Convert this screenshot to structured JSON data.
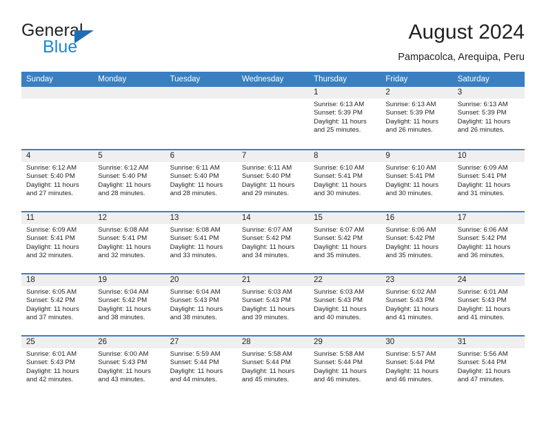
{
  "brand": {
    "name_top": "General",
    "name_bottom": "Blue",
    "triangle_color": "#1f6eb5",
    "blue_text_color": "#1b87d4"
  },
  "header": {
    "title": "August 2024",
    "subtitle": "Pampacolca, Arequipa, Peru"
  },
  "theme": {
    "header_bar_color": "#3a7fc1",
    "day_number_bg": "#efefef",
    "text_color": "#231f20"
  },
  "weekdays": [
    "Sunday",
    "Monday",
    "Tuesday",
    "Wednesday",
    "Thursday",
    "Friday",
    "Saturday"
  ],
  "weeks": [
    [
      {
        "day": "",
        "sunrise": "",
        "sunset": "",
        "daylight_line1": "",
        "daylight_line2": ""
      },
      {
        "day": "",
        "sunrise": "",
        "sunset": "",
        "daylight_line1": "",
        "daylight_line2": ""
      },
      {
        "day": "",
        "sunrise": "",
        "sunset": "",
        "daylight_line1": "",
        "daylight_line2": ""
      },
      {
        "day": "",
        "sunrise": "",
        "sunset": "",
        "daylight_line1": "",
        "daylight_line2": ""
      },
      {
        "day": "1",
        "sunrise": "Sunrise: 6:13 AM",
        "sunset": "Sunset: 5:39 PM",
        "daylight_line1": "Daylight: 11 hours",
        "daylight_line2": "and 25 minutes."
      },
      {
        "day": "2",
        "sunrise": "Sunrise: 6:13 AM",
        "sunset": "Sunset: 5:39 PM",
        "daylight_line1": "Daylight: 11 hours",
        "daylight_line2": "and 26 minutes."
      },
      {
        "day": "3",
        "sunrise": "Sunrise: 6:13 AM",
        "sunset": "Sunset: 5:39 PM",
        "daylight_line1": "Daylight: 11 hours",
        "daylight_line2": "and 26 minutes."
      }
    ],
    [
      {
        "day": "4",
        "sunrise": "Sunrise: 6:12 AM",
        "sunset": "Sunset: 5:40 PM",
        "daylight_line1": "Daylight: 11 hours",
        "daylight_line2": "and 27 minutes."
      },
      {
        "day": "5",
        "sunrise": "Sunrise: 6:12 AM",
        "sunset": "Sunset: 5:40 PM",
        "daylight_line1": "Daylight: 11 hours",
        "daylight_line2": "and 28 minutes."
      },
      {
        "day": "6",
        "sunrise": "Sunrise: 6:11 AM",
        "sunset": "Sunset: 5:40 PM",
        "daylight_line1": "Daylight: 11 hours",
        "daylight_line2": "and 28 minutes."
      },
      {
        "day": "7",
        "sunrise": "Sunrise: 6:11 AM",
        "sunset": "Sunset: 5:40 PM",
        "daylight_line1": "Daylight: 11 hours",
        "daylight_line2": "and 29 minutes."
      },
      {
        "day": "8",
        "sunrise": "Sunrise: 6:10 AM",
        "sunset": "Sunset: 5:41 PM",
        "daylight_line1": "Daylight: 11 hours",
        "daylight_line2": "and 30 minutes."
      },
      {
        "day": "9",
        "sunrise": "Sunrise: 6:10 AM",
        "sunset": "Sunset: 5:41 PM",
        "daylight_line1": "Daylight: 11 hours",
        "daylight_line2": "and 30 minutes."
      },
      {
        "day": "10",
        "sunrise": "Sunrise: 6:09 AM",
        "sunset": "Sunset: 5:41 PM",
        "daylight_line1": "Daylight: 11 hours",
        "daylight_line2": "and 31 minutes."
      }
    ],
    [
      {
        "day": "11",
        "sunrise": "Sunrise: 6:09 AM",
        "sunset": "Sunset: 5:41 PM",
        "daylight_line1": "Daylight: 11 hours",
        "daylight_line2": "and 32 minutes."
      },
      {
        "day": "12",
        "sunrise": "Sunrise: 6:08 AM",
        "sunset": "Sunset: 5:41 PM",
        "daylight_line1": "Daylight: 11 hours",
        "daylight_line2": "and 32 minutes."
      },
      {
        "day": "13",
        "sunrise": "Sunrise: 6:08 AM",
        "sunset": "Sunset: 5:41 PM",
        "daylight_line1": "Daylight: 11 hours",
        "daylight_line2": "and 33 minutes."
      },
      {
        "day": "14",
        "sunrise": "Sunrise: 6:07 AM",
        "sunset": "Sunset: 5:42 PM",
        "daylight_line1": "Daylight: 11 hours",
        "daylight_line2": "and 34 minutes."
      },
      {
        "day": "15",
        "sunrise": "Sunrise: 6:07 AM",
        "sunset": "Sunset: 5:42 PM",
        "daylight_line1": "Daylight: 11 hours",
        "daylight_line2": "and 35 minutes."
      },
      {
        "day": "16",
        "sunrise": "Sunrise: 6:06 AM",
        "sunset": "Sunset: 5:42 PM",
        "daylight_line1": "Daylight: 11 hours",
        "daylight_line2": "and 35 minutes."
      },
      {
        "day": "17",
        "sunrise": "Sunrise: 6:06 AM",
        "sunset": "Sunset: 5:42 PM",
        "daylight_line1": "Daylight: 11 hours",
        "daylight_line2": "and 36 minutes."
      }
    ],
    [
      {
        "day": "18",
        "sunrise": "Sunrise: 6:05 AM",
        "sunset": "Sunset: 5:42 PM",
        "daylight_line1": "Daylight: 11 hours",
        "daylight_line2": "and 37 minutes."
      },
      {
        "day": "19",
        "sunrise": "Sunrise: 6:04 AM",
        "sunset": "Sunset: 5:42 PM",
        "daylight_line1": "Daylight: 11 hours",
        "daylight_line2": "and 38 minutes."
      },
      {
        "day": "20",
        "sunrise": "Sunrise: 6:04 AM",
        "sunset": "Sunset: 5:43 PM",
        "daylight_line1": "Daylight: 11 hours",
        "daylight_line2": "and 38 minutes."
      },
      {
        "day": "21",
        "sunrise": "Sunrise: 6:03 AM",
        "sunset": "Sunset: 5:43 PM",
        "daylight_line1": "Daylight: 11 hours",
        "daylight_line2": "and 39 minutes."
      },
      {
        "day": "22",
        "sunrise": "Sunrise: 6:03 AM",
        "sunset": "Sunset: 5:43 PM",
        "daylight_line1": "Daylight: 11 hours",
        "daylight_line2": "and 40 minutes."
      },
      {
        "day": "23",
        "sunrise": "Sunrise: 6:02 AM",
        "sunset": "Sunset: 5:43 PM",
        "daylight_line1": "Daylight: 11 hours",
        "daylight_line2": "and 41 minutes."
      },
      {
        "day": "24",
        "sunrise": "Sunrise: 6:01 AM",
        "sunset": "Sunset: 5:43 PM",
        "daylight_line1": "Daylight: 11 hours",
        "daylight_line2": "and 41 minutes."
      }
    ],
    [
      {
        "day": "25",
        "sunrise": "Sunrise: 6:01 AM",
        "sunset": "Sunset: 5:43 PM",
        "daylight_line1": "Daylight: 11 hours",
        "daylight_line2": "and 42 minutes."
      },
      {
        "day": "26",
        "sunrise": "Sunrise: 6:00 AM",
        "sunset": "Sunset: 5:43 PM",
        "daylight_line1": "Daylight: 11 hours",
        "daylight_line2": "and 43 minutes."
      },
      {
        "day": "27",
        "sunrise": "Sunrise: 5:59 AM",
        "sunset": "Sunset: 5:44 PM",
        "daylight_line1": "Daylight: 11 hours",
        "daylight_line2": "and 44 minutes."
      },
      {
        "day": "28",
        "sunrise": "Sunrise: 5:58 AM",
        "sunset": "Sunset: 5:44 PM",
        "daylight_line1": "Daylight: 11 hours",
        "daylight_line2": "and 45 minutes."
      },
      {
        "day": "29",
        "sunrise": "Sunrise: 5:58 AM",
        "sunset": "Sunset: 5:44 PM",
        "daylight_line1": "Daylight: 11 hours",
        "daylight_line2": "and 46 minutes."
      },
      {
        "day": "30",
        "sunrise": "Sunrise: 5:57 AM",
        "sunset": "Sunset: 5:44 PM",
        "daylight_line1": "Daylight: 11 hours",
        "daylight_line2": "and 46 minutes."
      },
      {
        "day": "31",
        "sunrise": "Sunrise: 5:56 AM",
        "sunset": "Sunset: 5:44 PM",
        "daylight_line1": "Daylight: 11 hours",
        "daylight_line2": "and 47 minutes."
      }
    ]
  ]
}
